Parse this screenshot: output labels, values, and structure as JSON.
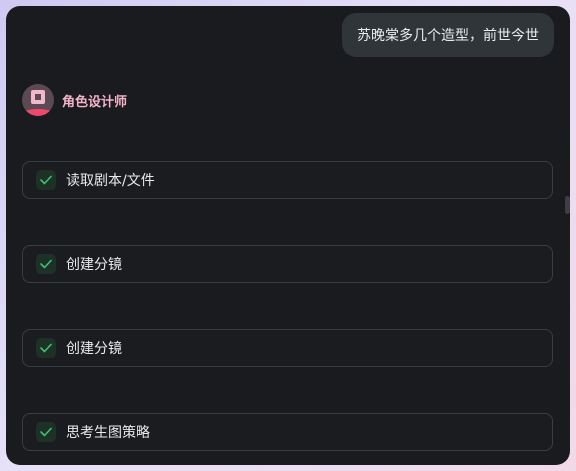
{
  "chat": {
    "user_message": "苏晚棠多几个造型，前世今世"
  },
  "agent": {
    "name": "角色设计师"
  },
  "steps": [
    {
      "label": "读取剧本/文件"
    },
    {
      "label": "创建分镜"
    },
    {
      "label": "创建分镜"
    },
    {
      "label": "思考生图策略"
    }
  ],
  "colors": {
    "panel_bg": "#1a1b1e",
    "agent_name": "#f5b3c9",
    "check": "#3fbf76"
  }
}
